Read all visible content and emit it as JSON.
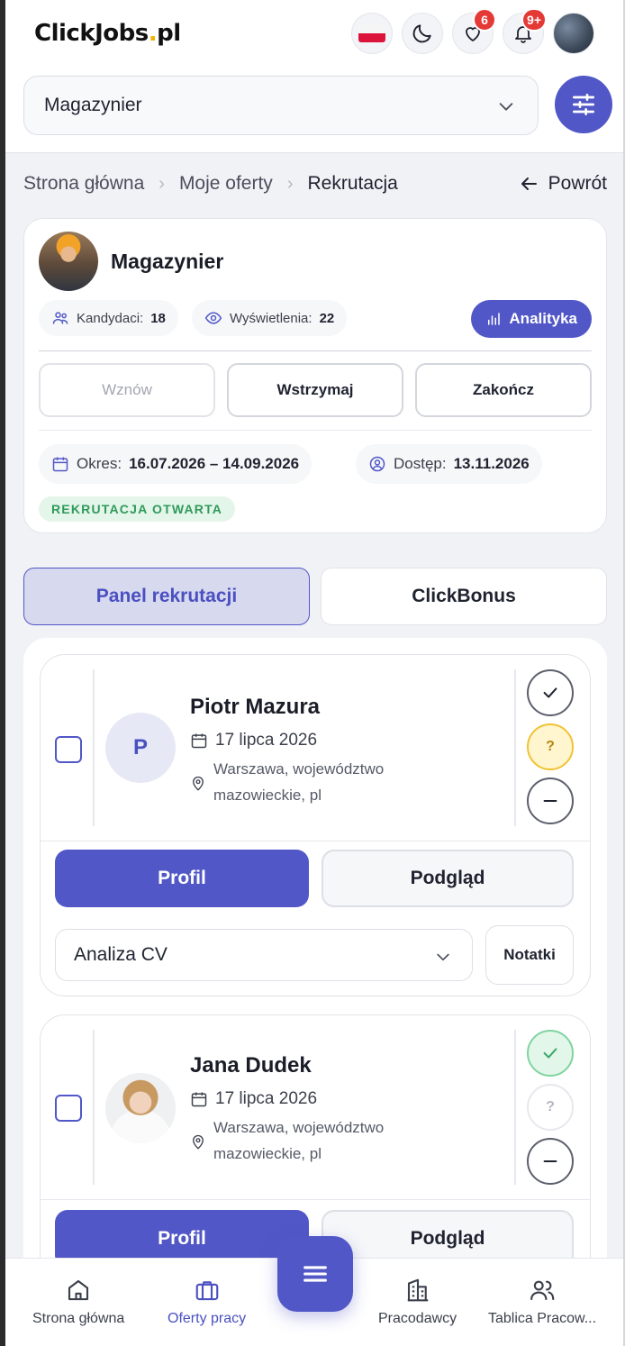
{
  "header": {
    "logo_main": "ClickJobs",
    "logo_dot": ".",
    "logo_tld": "pl",
    "favorites_count": "6",
    "notifications_count": "9+"
  },
  "search": {
    "selected_value": "Magazynier"
  },
  "breadcrumb": {
    "items": [
      "Strona główna",
      "Moje oferty",
      "Rekrutacja"
    ],
    "back_label": "Powrót"
  },
  "offer": {
    "title": "Magazynier",
    "candidates_label": "Kandydaci:",
    "candidates_value": "18",
    "views_label": "Wyświetlenia:",
    "views_value": "22",
    "analytics_label": "Analityka",
    "actions": {
      "resume": "Wznów",
      "pause": "Wstrzymaj",
      "finish": "Zakończ"
    },
    "period_label": "Okres:",
    "period_value": "16.07.2026 – 14.09.2026",
    "access_label": "Dostęp:",
    "access_value": "13.11.2026",
    "status": "REKRUTACJA OTWARTA"
  },
  "tabs": {
    "panel": "Panel rekrutacji",
    "bonus": "ClickBonus"
  },
  "candidates": [
    {
      "initial": "P",
      "name": "Piotr Mazura",
      "date": "17 lipca 2026",
      "location": "Warszawa, województwo mazowieckie, pl",
      "profile_label": "Profil",
      "preview_label": "Podgląd",
      "stage": "Analiza CV",
      "notes_label": "Notatki",
      "question_mark": "?"
    },
    {
      "name": "Jana Dudek",
      "date": "17 lipca 2026",
      "location": "Warszawa, województwo mazowieckie, pl",
      "profile_label": "Profil",
      "preview_label": "Podgląd",
      "question_mark": "?"
    }
  ],
  "bottom_nav": {
    "home": "Strona główna",
    "offers": "Oferty pracy",
    "employers": "Pracodawcy",
    "board": "Tablica Pracow..."
  },
  "colors": {
    "accent": "#5157c7",
    "status_green": "#2f9a5a",
    "badge_red": "#e53935",
    "logo_dot": "#f1b400"
  }
}
